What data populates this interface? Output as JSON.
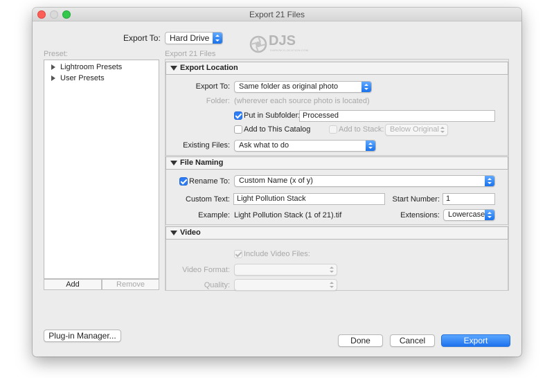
{
  "window": {
    "title": "Export 21 Files"
  },
  "top": {
    "export_to_label": "Export To:",
    "export_to_value": "Hard Drive",
    "subtitle": "Export 21 Files"
  },
  "watermark": {
    "logo_text": "DJS",
    "sub_text": "DARKSKYLOCATION.COM"
  },
  "presets": {
    "label": "Preset:",
    "items": [
      {
        "label": "Lightroom Presets"
      },
      {
        "label": "User Presets"
      }
    ],
    "add_label": "Add",
    "remove_label": "Remove"
  },
  "export_location": {
    "title": "Export Location",
    "export_to_label": "Export To:",
    "export_to_value": "Same folder as original photo",
    "folder_label": "Folder:",
    "folder_value": "(wherever each source photo is located)",
    "subfolder_checked": true,
    "subfolder_label": "Put in Subfolder:",
    "subfolder_value": "Processed",
    "add_catalog_label": "Add to This Catalog",
    "add_stack_label": "Add to Stack:",
    "stack_value": "Below Original",
    "existing_files_label": "Existing Files:",
    "existing_files_value": "Ask what to do"
  },
  "file_naming": {
    "title": "File Naming",
    "rename_checked": true,
    "rename_label": "Rename To:",
    "rename_value": "Custom Name (x of y)",
    "custom_text_label": "Custom Text:",
    "custom_text_value": "Light Pollution Stack",
    "start_number_label": "Start Number:",
    "start_number_value": "1",
    "example_label": "Example:",
    "example_value": "Light Pollution Stack (1 of 21).tif",
    "extensions_label": "Extensions:",
    "extensions_value": "Lowercase"
  },
  "video": {
    "title": "Video",
    "include_label": "Include Video Files:",
    "format_label": "Video Format:",
    "quality_label": "Quality:"
  },
  "footer": {
    "plugin_manager_label": "Plug-in Manager...",
    "done_label": "Done",
    "cancel_label": "Cancel",
    "export_label": "Export"
  },
  "colors": {
    "accent": "#1e72ee",
    "window_bg": "#ececec"
  }
}
